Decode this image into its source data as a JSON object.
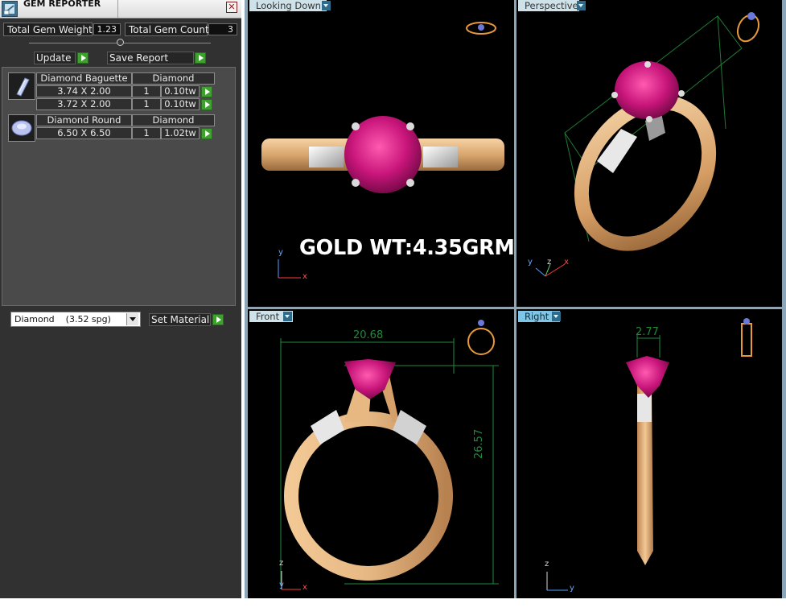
{
  "window": {
    "title": "GEM REPORTER",
    "close_glyph": "✕",
    "app_icon": "gem-reporter-icon"
  },
  "totals": {
    "weight_label": "Total Gem Weight",
    "weight_value": "1.23",
    "count_label": "Total Gem Count",
    "count_value": "3"
  },
  "actions": {
    "update_label": "Update",
    "save_report_label": "Save Report"
  },
  "gem_groups": [
    {
      "name": "Diamond Baguette",
      "material": "Diamond",
      "icon": "baguette-gem-icon",
      "rows": [
        {
          "size": "3.74 X 2.00",
          "count": "1",
          "weight": "0.10tw"
        },
        {
          "size": "3.72 X 2.00",
          "count": "1",
          "weight": "0.10tw"
        }
      ]
    },
    {
      "name": "Diamond Round",
      "material": "Diamond",
      "icon": "round-gem-icon",
      "rows": [
        {
          "size": "6.50 X 6.50",
          "count": "1",
          "weight": "1.02tw"
        }
      ]
    }
  ],
  "material": {
    "selected": "Diamond    (3.52 spg)",
    "set_label": "Set Material"
  },
  "viewports": {
    "top_left": {
      "label": "Looking Down",
      "annotation": "GOLD WT:4.35GRM"
    },
    "top_right": {
      "label": "Perspective"
    },
    "bottom_left": {
      "label": "Front",
      "width_dim": "20.68",
      "height_dim": "26.57"
    },
    "bottom_right": {
      "label": "Right",
      "width_dim": "2.77"
    }
  },
  "axes": {
    "x": "x",
    "y": "y",
    "z": "z"
  },
  "colors": {
    "panel_bg": "#313131",
    "viewport_bg": "#000000",
    "active_tab": "#7fc6e6",
    "go_button": "#3ea12e",
    "gold": "#e0b07a",
    "ruby": "#c8157a",
    "dimension": "#1f8a3a"
  }
}
